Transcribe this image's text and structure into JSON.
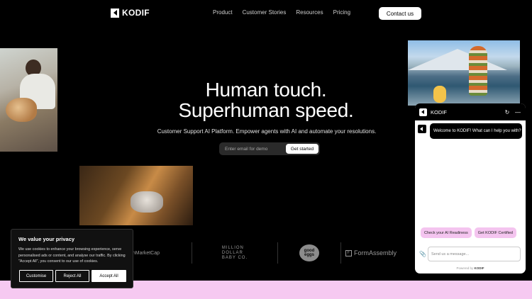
{
  "brand": {
    "name": "KODIF"
  },
  "nav": {
    "items": [
      "Product",
      "Customer Stories",
      "Resources",
      "Pricing"
    ],
    "contact_label": "Contact us"
  },
  "hero": {
    "title_line1": "Human touch.",
    "title_line2": "Superhuman speed.",
    "subtitle": "Customer Support AI Platform. Empower agents with AI and automate your resolutions.",
    "email_placeholder": "Enter email for demo",
    "cta_label": "Get started"
  },
  "logos": {
    "item1": "ainMarketCap",
    "item2_lines": [
      "MILLION",
      "DOLLAR",
      "BABY CO."
    ],
    "item3": "good eggs",
    "item4": "FormAssembly"
  },
  "cookie": {
    "title": "We value your privacy",
    "text": "We use cookies to enhance your browsing experience, serve personalised ads or content, and analyse our traffic. By clicking \"Accept All\", you consent to our use of cookies.",
    "customise_label": "Customise",
    "reject_label": "Reject All",
    "accept_label": "Accept All"
  },
  "chat": {
    "title": "KODIF",
    "welcome": "Welcome to KODIF! What can I help you with?",
    "chip1": "Check your AI Readiness",
    "chip2": "Get KODIF Certified",
    "input_placeholder": "Send us a message...",
    "powered_prefix": "Powered by",
    "powered_brand": "KODIF"
  },
  "colors": {
    "background": "#000000",
    "pink_band": "#f6c9f1",
    "chip_pink": "#f4c4ef"
  }
}
